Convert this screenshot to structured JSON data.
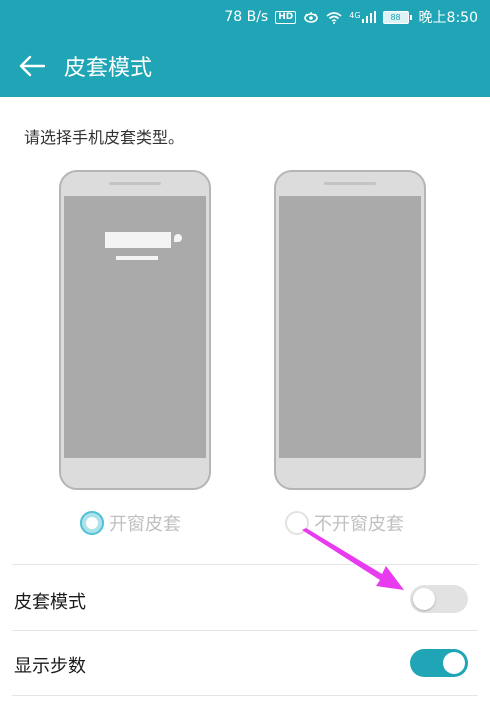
{
  "colors": {
    "accent": "#1fa5b5",
    "arrow": "#e83bf0"
  },
  "status_bar": {
    "speed": "78 B/s",
    "hd_badge": "HD",
    "network_badge": "4G",
    "battery": "88",
    "time": "晚上8:50"
  },
  "app_bar": {
    "back_icon": "arrow-left-icon",
    "title": "皮套模式"
  },
  "prompt": "请选择手机皮套类型。",
  "cover_options": [
    {
      "label": "开窗皮套",
      "selected": true
    },
    {
      "label": "不开窗皮套",
      "selected": false
    }
  ],
  "settings": [
    {
      "label": "皮套模式",
      "enabled": false
    },
    {
      "label": "显示步数",
      "enabled": true
    }
  ]
}
